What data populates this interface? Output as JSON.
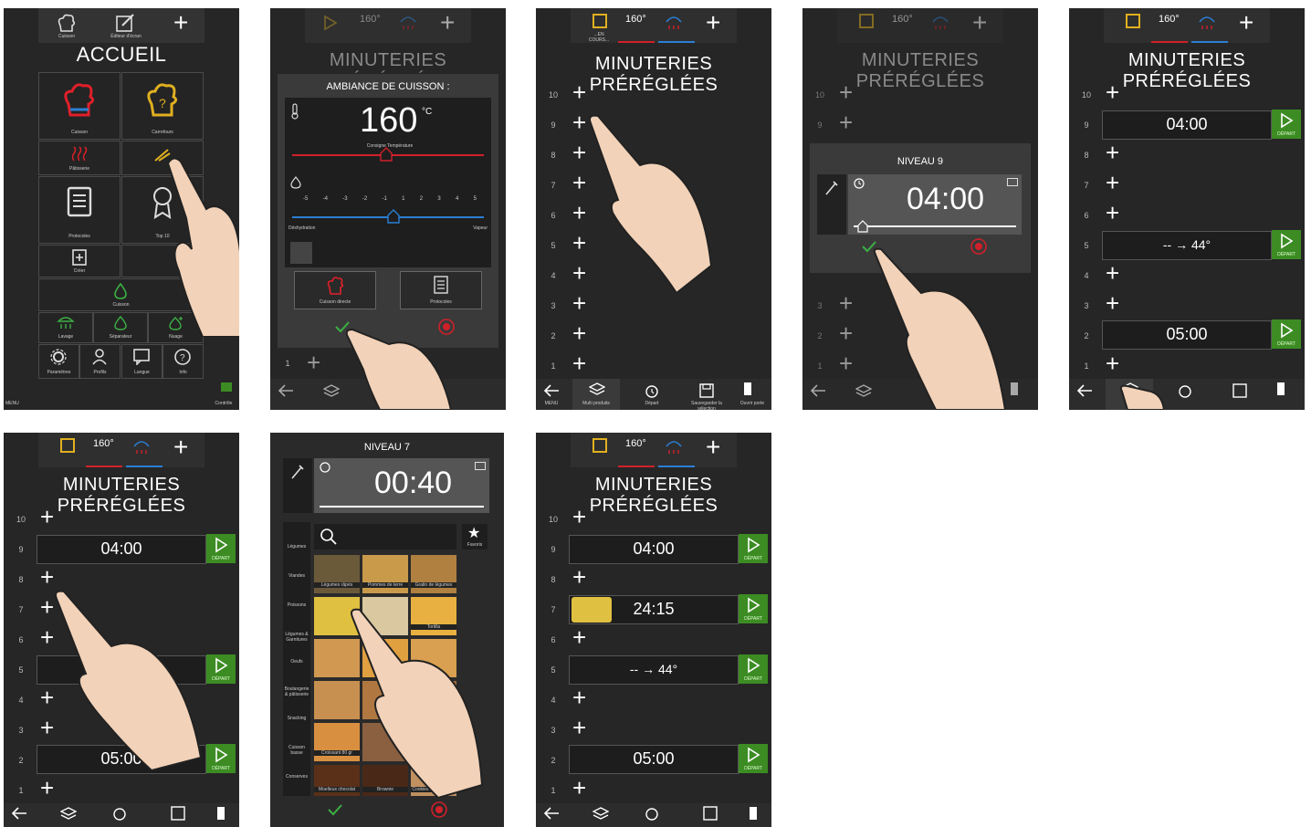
{
  "screen1": {
    "title": "ACCUEIL",
    "top_labels": [
      "Cuisson",
      "Éditeur d'écran"
    ],
    "tiles": [
      "Cuisson",
      "Carrefours",
      "Pâtisserie",
      "",
      "Protocoles",
      "Top 10",
      "Créer",
      "",
      "Cuisson",
      "Lavage",
      "Séparateur",
      "Nuage"
    ],
    "bottom_labels": [
      "Paramètres",
      "Profils",
      "Langue",
      "Info"
    ],
    "corner_right": "Contrôle",
    "corner_left": "MENU"
  },
  "screen2": {
    "title": "MINUTERIES PRÉRÉGLÉES",
    "dialog_title": "AMBIANCE DE CUISSON :",
    "temperature": "160",
    "temp_unit": "°C",
    "temp_caption": "Consigne Température",
    "humidity_scale": [
      "-5",
      "-4",
      "-3",
      "-2",
      "-1",
      "1",
      "2",
      "3",
      "4",
      "5"
    ],
    "humidity_left": "Déshydration",
    "humidity_right": "Vapeur",
    "button_left": "Cuisson directe",
    "button_right": "Protocoles",
    "level_1": "1",
    "top_badge": "160°"
  },
  "levels": [
    "10",
    "9",
    "8",
    "7",
    "6",
    "5",
    "4",
    "3",
    "2",
    "1"
  ],
  "screen3": {
    "title": "MINUTERIES PRÉRÉGLÉES",
    "top_badge": "160°",
    "top_label": "...EN COURS...",
    "bottom_labels": [
      "MENU",
      "Multi produits",
      "Départ",
      "Sauvegarder la sélection",
      "Ouvrir porte"
    ]
  },
  "screen4": {
    "title": "MINUTERIES PRÉRÉGLÉES",
    "dialog_title": "NIVEAU 9",
    "timer": "04:00",
    "top_badge": "160°"
  },
  "screen5": {
    "title": "MINUTERIES PRÉRÉGLÉES",
    "top_badge": "160°",
    "timer_9": "04:00",
    "timer_5": "-- → 44°",
    "timer_2": "05:00",
    "start_label": "DÉPART"
  },
  "screen6": {
    "title": "MINUTERIES PRÉRÉGLÉES",
    "top_badge": "160°",
    "timer_9": "04:00",
    "timer_2": "05:00",
    "start_label": "DÉPART"
  },
  "screen7": {
    "dialog_title": "NIVEAU 7",
    "timer": "00:40",
    "categories": [
      "Légumes",
      "Viandes",
      "Poissons",
      "Légumes & Garnitures",
      "Oeufs",
      "Boulangerie & pâtisserie",
      "Snacking",
      "Cuisson basse",
      "Conserves"
    ],
    "food_labels": [
      "Légumes râpés",
      "Pommes de terre",
      "Gratin de légumes",
      "",
      "",
      "Tortilla",
      "",
      "",
      "",
      "",
      "",
      "",
      "Croissant 80 gr",
      "",
      "",
      "Moelleux chocolat",
      "Brownie",
      "Cookies / Sablés 40g"
    ],
    "favorites": "Favoris"
  },
  "screen8": {
    "title": "MINUTERIES PRÉRÉGLÉES",
    "top_badge": "160°",
    "timer_9": "04:00",
    "timer_7": "24:15",
    "timer_5": "-- → 44°",
    "timer_2": "05:00",
    "start_label": "DÉPART"
  },
  "colors": {
    "bg": "#262626",
    "accent_green": "#3c8c23",
    "accent_red": "#d0202a",
    "accent_blue": "#2a7fd4",
    "accent_yellow": "#e0b020"
  }
}
